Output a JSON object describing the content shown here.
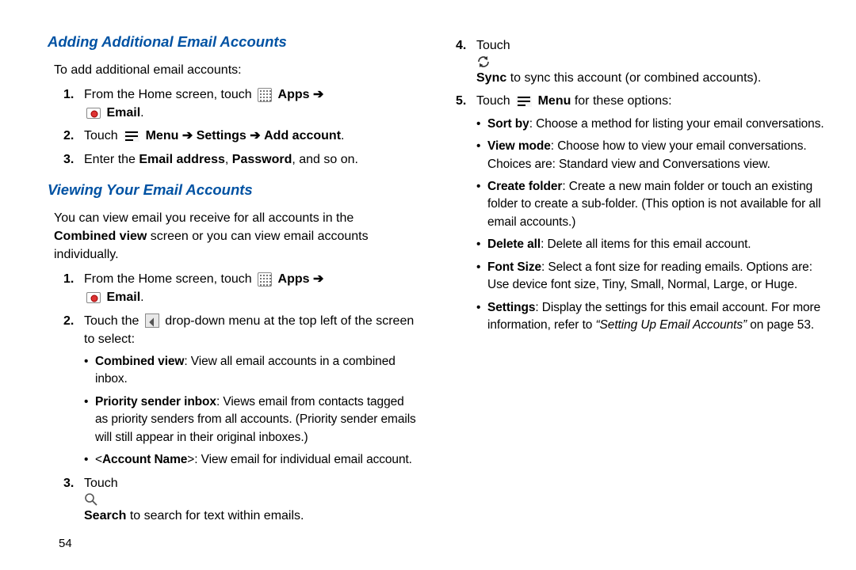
{
  "page_number": "54",
  "left": {
    "h1": "Adding Additional Email Accounts",
    "intro": "To add additional email accounts:",
    "s1_num": "1.",
    "s1_a": "From the Home screen, touch ",
    "s1_apps": "Apps",
    "s1_arrow": "➔",
    "s1_email": "Email",
    "s2_num": "2.",
    "s2_a": "Touch ",
    "s2_menu": "Menu",
    "s2_arr1": "➔",
    "s2_settings": "Settings",
    "s2_arr2": "➔",
    "s2_addacct": "Add account",
    "s3_num": "3.",
    "s3_a": "Enter the ",
    "s3_em": "Email address",
    "s3_comma": ", ",
    "s3_pw": "Password",
    "s3_b": ", and so on.",
    "h2": "Viewing Your Email Accounts",
    "intro2a": "You can view email you receive for all accounts in the ",
    "intro2b": "Combined view",
    "intro2c": " screen or you can view email accounts individually.",
    "v1_num": "1.",
    "v1_a": "From the Home screen, touch ",
    "v1_apps": "Apps",
    "v1_arrow": "➔",
    "v1_email": "Email",
    "v2_num": "2.",
    "v2_a": "Touch the ",
    "v2_b": " drop-down menu at the top left of the screen to select:",
    "b1_label": "Combined view",
    "b1_text": ": View all email accounts in a combined inbox.",
    "b2_label": "Priority sender inbox",
    "b2_text": ": Views email from contacts tagged as priority senders from all accounts. (Priority sender emails will still appear in their original inboxes.)",
    "b3_pre": "<",
    "b3_label": "Account Name",
    "b3_post": ">: View email for individual email account.",
    "v3_num": "3.",
    "v3_a": "Touch ",
    "v3_search": "Search",
    "v3_b": " to search for text within emails."
  },
  "right": {
    "s4_num": "4.",
    "s4_a": "Touch ",
    "s4_sync": "Sync",
    "s4_b": " to sync this account (or combined accounts).",
    "s5_num": "5.",
    "s5_a": "Touch ",
    "s5_menu": "Menu",
    "s5_b": " for these options:",
    "r1_label": "Sort by",
    "r1_text": ": Choose a method for listing your email conversations.",
    "r2_label": "View mode",
    "r2_text": ": Choose how to view your email conversations. Choices are: Standard view and Conversations view.",
    "r3_label": "Create folder",
    "r3_text": ": Create a new main folder or touch an existing folder to create a sub-folder. (This option is not available for all email accounts.)",
    "r4_label": "Delete all",
    "r4_text": ": Delete all items for this email account.",
    "r5_label": "Font Size",
    "r5_text": ": Select a font size for reading emails. Options are: Use device font size, Tiny, Small, Normal, Large, or Huge.",
    "r6_label": "Settings",
    "r6_text1": ": Display the settings for this email account. For more information, refer to ",
    "r6_ref": "“Setting Up Email Accounts”",
    "r6_text2": "  on page 53."
  }
}
